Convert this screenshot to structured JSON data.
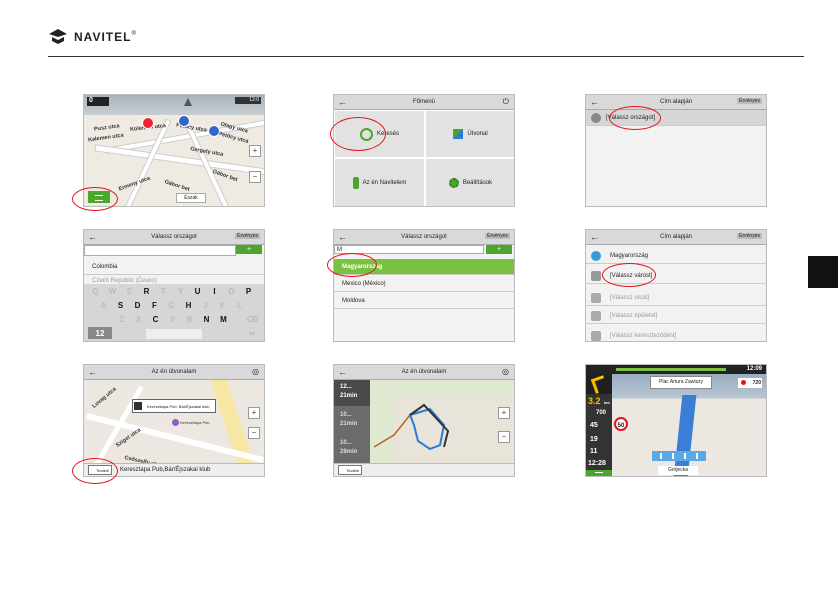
{
  "brand": {
    "name": "NAVITEL",
    "mark": "®"
  },
  "shot1": {
    "speed": "0",
    "time": "12:0",
    "streets": [
      "Pusz utca",
      "Kolemen utca",
      "Kalemen utca",
      "Petőcy utca",
      "Petőcy utca",
      "Olagy utca",
      "Gergely utca",
      "Gábor bet",
      "Ermeny utca",
      "Petőcy utca",
      "Gábor bet"
    ],
    "north_label": "Észak"
  },
  "shot2": {
    "title": "Főmenü",
    "tiles": [
      "Keresés",
      "Útvonal",
      "Az én Navitelem",
      "Beállítások"
    ]
  },
  "shot3": {
    "title": "Cím alapján",
    "right_button": "Érvényes",
    "row": "[Válassz országot]"
  },
  "shot4": {
    "title": "Válassz országot",
    "right_button": "Érvényes",
    "rows": [
      "Colombia",
      "Czech Republic (Česko)"
    ],
    "keys_row1": [
      "Q",
      "W",
      "E",
      "R",
      "T",
      "Y",
      "U",
      "I",
      "O",
      "P"
    ],
    "keys_row2": [
      "A",
      "S",
      "D",
      "F",
      "G",
      "H",
      "J",
      "K",
      "L"
    ],
    "keys_row3": [
      "Z",
      "X",
      "C",
      "V",
      "B",
      "N",
      "M"
    ],
    "num_key": "12"
  },
  "shot5": {
    "title": "Válassz országot",
    "right_button": "Érvényes",
    "search_value": "M",
    "rows": [
      "Magyarország",
      "Mexico (México)",
      "Moldova"
    ]
  },
  "shot6": {
    "title": "Cím alapján",
    "right_button": "Érvényes",
    "rows": [
      "Magyarország",
      "[Válassz várost]",
      "[Válassz utcát]",
      "[Válassz épületet]",
      "[Válassz kereszteződést]"
    ]
  },
  "shot7": {
    "title": "Az én útvonalam",
    "popup": "Kereszttapa Pub, Bár/Éjszakai klub",
    "pin_label": "Kereszttapa Pub",
    "go_button": "Tovább",
    "bottom_text": "Keresztapa Pub,Bár/Éjszakai klub",
    "streets": [
      "Lovag utca",
      "Sziget utca",
      "Csőszelfy utca"
    ]
  },
  "shot8": {
    "title": "Az én útvonalam",
    "routes": [
      {
        "dist": "12...",
        "time": "21min"
      },
      {
        "dist": "10...",
        "time": "21min"
      },
      {
        "dist": "10...",
        "time": "28min"
      }
    ],
    "go_button": "Tovább"
  },
  "shot9": {
    "street": "Plac Artura Zawiszy",
    "time": "12:09",
    "dist1": "3.2",
    "dist1_unit": "km",
    "dist2": "700",
    "speed": "45",
    "limit": "50",
    "eta1": "19",
    "eta2": "11",
    "eta3": "12:28",
    "speedcam": "720",
    "bottom_street": "Grójecka"
  }
}
